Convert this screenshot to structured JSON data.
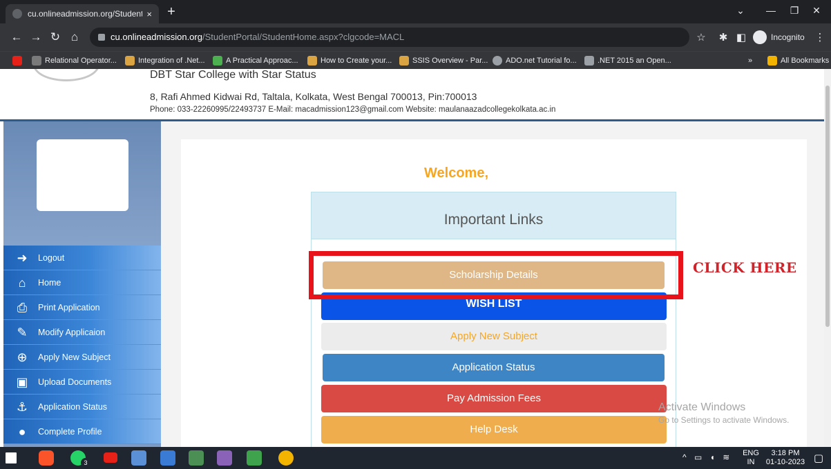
{
  "browser": {
    "tab_title": "cu.onlineadmission.org/Student",
    "tab_close": "×",
    "new_tab": "+",
    "url_domain": "cu.onlineadmission.org",
    "url_path": "/StudentPortal/StudentHome.aspx?clgcode=MACL",
    "incognito_label": "Incognito",
    "bookmarks": [
      {
        "label": "Relational Operator...",
        "color": "#7a7a7a"
      },
      {
        "label": "Integration of .Net...",
        "color": "#d9a441"
      },
      {
        "label": "A Practical Approac...",
        "color": "#4caf50"
      },
      {
        "label": "How to Create your...",
        "color": "#d9a441"
      },
      {
        "label": "SSIS Overview - Par...",
        "color": "#d9a441"
      },
      {
        "label": "ADO.net Tutorial fo...",
        "color": "#9aa0a6"
      },
      {
        "label": ".NET 2015 an Open...",
        "color": "#9aa0a6"
      }
    ],
    "bookmarks_more": "»",
    "all_bookmarks": "All Bookmarks"
  },
  "header": {
    "college_sub": "DBT Star College with Star Status",
    "address": "8, Rafi Ahmed Kidwai Rd, Taltala, Kolkata, West Bengal 700013, Pin:700013",
    "contact": "Phone: 033-22260995/22493737 E-Mail: macadmission123@gmail.com Website: maulanaazadcollegekolkata.ac.in"
  },
  "sidebar": {
    "items": [
      {
        "label": "Logout",
        "icon": "logout-icon"
      },
      {
        "label": "Home",
        "icon": "home-icon"
      },
      {
        "label": "Print Application",
        "icon": "print-icon"
      },
      {
        "label": "Modify Applicaion",
        "icon": "edit-icon"
      },
      {
        "label": "Apply New Subject",
        "icon": "plus-circle-icon"
      },
      {
        "label": "Upload Documents",
        "icon": "image-icon"
      },
      {
        "label": "Application Status",
        "icon": "anchor-icon"
      },
      {
        "label": "Complete Profile",
        "icon": "user-icon"
      }
    ]
  },
  "main": {
    "welcome": "Welcome,",
    "links_title": "Important Links",
    "buttons": {
      "scholarship": "Scholarship Details",
      "wish_list": "WISH LIST",
      "apply_subject": "Apply New Subject",
      "app_status": "Application Status",
      "pay_fees": "Pay Admission Fees",
      "help_desk": "Help Desk"
    },
    "annotation": "CLICK HERE"
  },
  "watermark": {
    "line1": "Activate Windows",
    "line2": "Go to Settings to activate Windows."
  },
  "taskbar": {
    "lang_top": "ENG",
    "lang_bottom": "IN",
    "time": "3:18 PM",
    "date": "01-10-2023",
    "whatsapp_badge": "3"
  },
  "colors": {
    "accent_orange": "#f5a623",
    "highlight_red": "#e8121b",
    "wish_blue": "#0b54e8"
  }
}
